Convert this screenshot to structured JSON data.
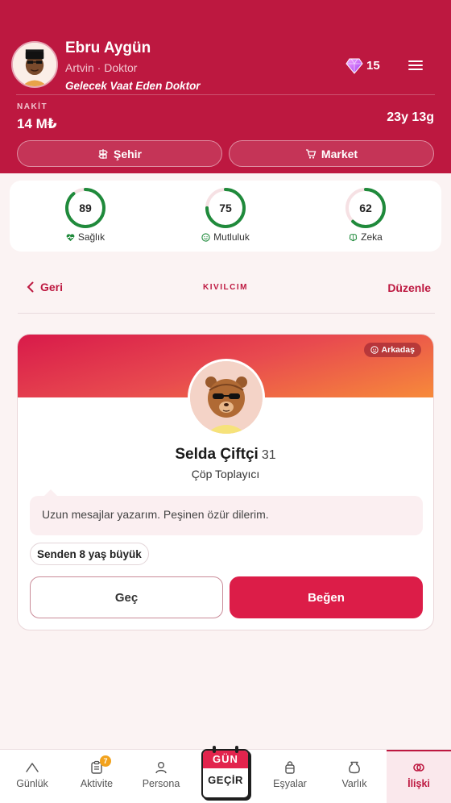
{
  "header": {
    "player_name": "Ebru Aygün",
    "player_location_job": "Artvin · Doktor",
    "player_title": "Gelecek Vaat Eden Doktor",
    "gems": "15",
    "cash_label": "NAKİT",
    "cash_value": "14 M₺",
    "age": "23y 13g",
    "city_button": "Şehir",
    "market_button": "Market",
    "brand_color": "#bd1840"
  },
  "stats": [
    {
      "label": "Sağlık",
      "value": "89",
      "icon": "heartbeat-icon"
    },
    {
      "label": "Mutluluk",
      "value": "75",
      "icon": "smile-icon"
    },
    {
      "label": "Zeka",
      "value": "62",
      "icon": "brain-icon"
    }
  ],
  "nav_row": {
    "back_label": "Geri",
    "section_title": "KIVILCIM",
    "edit_label": "Düzenle"
  },
  "match": {
    "relationship_badge": "Arkadaş",
    "name": "Selda Çiftçi",
    "age": "31",
    "job": "Çöp Toplayıcı",
    "bio": "Uzun mesajlar yazarım. Peşinen özür dilerim.",
    "age_difference": "Senden 8 yaş büyük",
    "skip_button": "Geç",
    "like_button": "Beğen"
  },
  "bottom_nav": {
    "items": [
      {
        "label": "Günlük",
        "icon": "chart-icon"
      },
      {
        "label": "Aktivite",
        "icon": "checklist-icon",
        "badge": "7"
      },
      {
        "label": "Persona",
        "icon": "person-icon"
      },
      {
        "label": "Eşyalar",
        "icon": "bag-icon"
      },
      {
        "label": "Varlık",
        "icon": "money-bag-icon"
      },
      {
        "label": "İlişki",
        "icon": "rings-icon"
      }
    ],
    "active": "İlişki",
    "day_button_top": "GÜN",
    "day_button_bottom": "GEÇİR"
  }
}
